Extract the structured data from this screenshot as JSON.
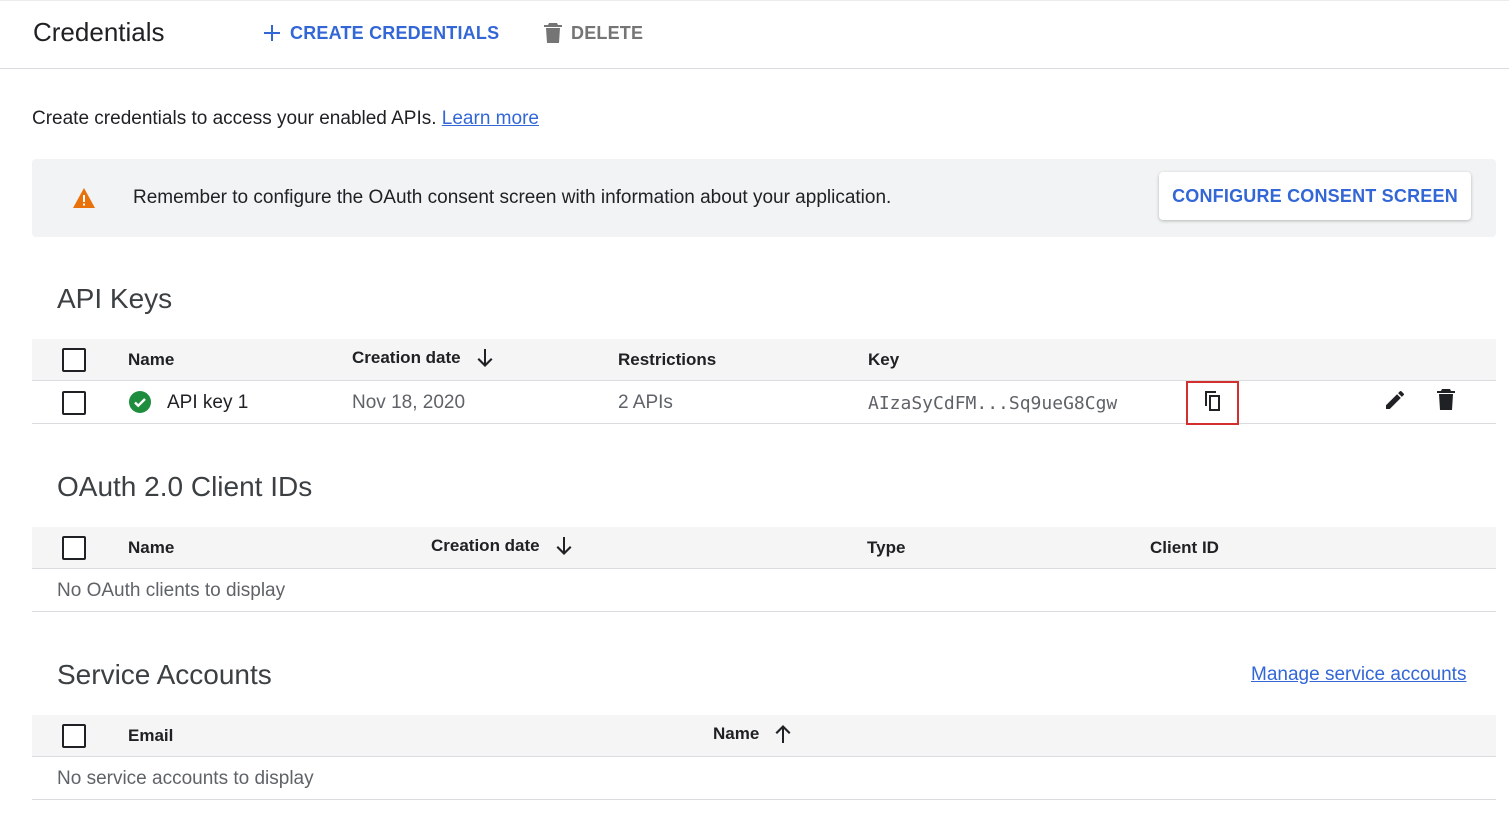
{
  "header": {
    "title": "Credentials",
    "create_label": "CREATE CREDENTIALS",
    "delete_label": "DELETE"
  },
  "intro": {
    "text": "Create credentials to access your enabled APIs.",
    "learn_more": "Learn more"
  },
  "banner": {
    "message": "Remember to configure the OAuth consent screen with information about your application.",
    "button": "CONFIGURE CONSENT SCREEN",
    "icon": "warning-icon",
    "icon_color": "#e8710a"
  },
  "api_keys": {
    "title": "API Keys",
    "columns": [
      "Name",
      "Creation date",
      "Restrictions",
      "Key"
    ],
    "rows": [
      {
        "name": "API key 1",
        "created": "Nov 18, 2020",
        "restrictions": "2 APIs",
        "key": "AIzaSyCdFM...Sq9ueG8Cgw",
        "status_color": "#1e8e3e"
      }
    ]
  },
  "oauth": {
    "title": "OAuth 2.0 Client IDs",
    "columns": [
      "Name",
      "Creation date",
      "Type",
      "Client ID"
    ],
    "empty": "No OAuth clients to display"
  },
  "service_accounts": {
    "title": "Service Accounts",
    "manage_link": "Manage service accounts",
    "columns": [
      "Email",
      "Name"
    ],
    "empty": "No service accounts to display"
  },
  "colors": {
    "accent": "#3367d6",
    "highlight": "#d32f2f"
  }
}
